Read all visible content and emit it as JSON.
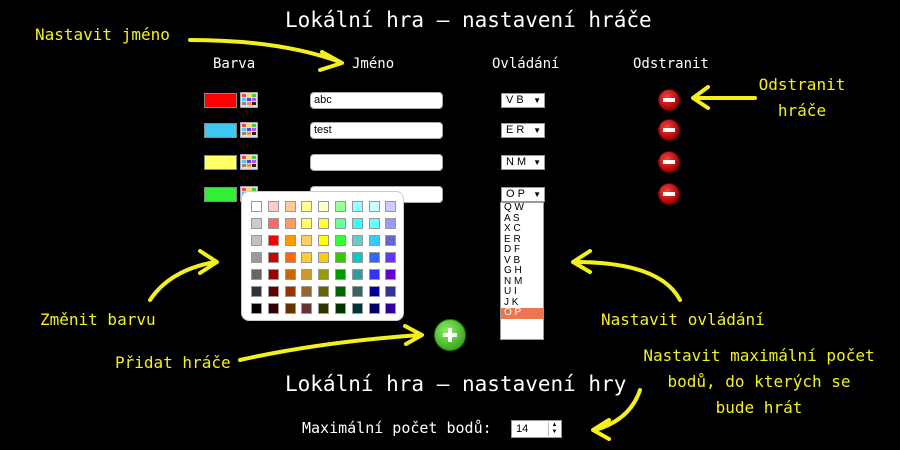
{
  "titles": {
    "player_settings": "Lokální hra – nastavení hráče",
    "game_settings": "Lokální hra – nastavení hry"
  },
  "columns": {
    "color": "Barva",
    "name": "Jméno",
    "controls": "Ovládání",
    "remove": "Odstranit"
  },
  "annotations": {
    "set_name": "Nastavit jméno",
    "remove_player_1": "Odstranit",
    "remove_player_2": "hráče",
    "change_color": "Změnit barvu",
    "set_controls": "Nastavit ovládání",
    "add_player": "Přidat hráče",
    "max_points_1": "Nastavit maximální počet",
    "max_points_2": "bodů, do kterých se",
    "max_points_3": "bude hrát"
  },
  "players": [
    {
      "color": "#ff0000",
      "name": "abc",
      "controls": "V B"
    },
    {
      "color": "#3fc8f0",
      "name": "test",
      "controls": "E R"
    },
    {
      "color": "#ffff66",
      "name": "",
      "controls": "N M"
    },
    {
      "color": "#33ee33",
      "name": "",
      "controls": "O P"
    }
  ],
  "dropdown_options": [
    "Q W",
    "A S",
    "X C",
    "E R",
    "D F",
    "V B",
    "G H",
    "N M",
    "U I",
    "J K",
    "O P"
  ],
  "dropdown_selected": "O P",
  "max_points": {
    "label": "Maximální počet bodů:",
    "value": "14"
  },
  "icons": {
    "palette": "palette-icon",
    "remove": "remove-player-icon",
    "add": "add-player-icon",
    "dropdown": "chevron-down-icon"
  },
  "colors": {
    "background": "#000000",
    "annotation": "#f4f020",
    "selected_option": "#e9764c"
  }
}
